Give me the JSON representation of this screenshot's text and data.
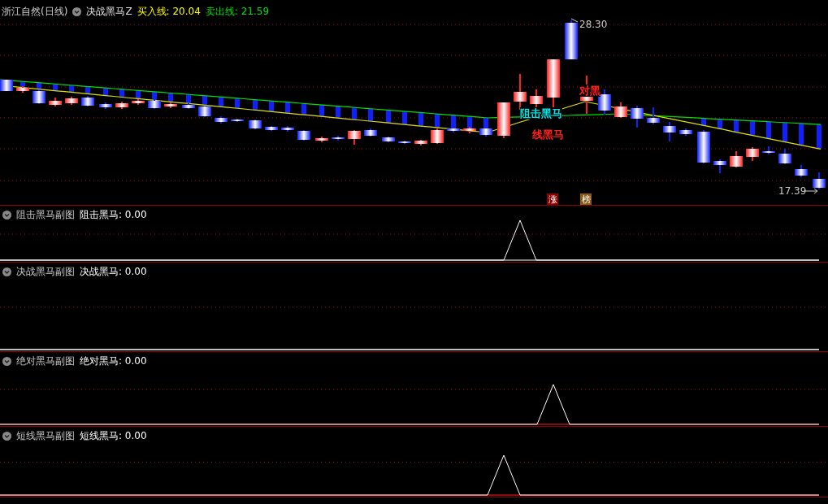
{
  "header": {
    "stock": "浙江自然(日线)",
    "indicator": "决战黑马Z",
    "buy_line": "买入线: 20.04",
    "sell_line": "卖出线: 21.59"
  },
  "annotations": [
    {
      "kind": "high",
      "text": "28.30"
    },
    {
      "kind": "low",
      "text": "17.39"
    },
    {
      "kind": "signal",
      "text": "阻击黑马",
      "color": "#00e5e5"
    },
    {
      "kind": "signal",
      "text": "线黑马",
      "color": "#ff2020"
    },
    {
      "kind": "signal",
      "text": "对黑",
      "color": "#ff2020"
    },
    {
      "kind": "badge",
      "text": "涨",
      "color": "#8b0000"
    },
    {
      "kind": "badge",
      "text": "榜",
      "color": "#8b5a1a"
    }
  ],
  "panels": [
    {
      "title": "阻击黑马副图",
      "series": "阻击黑马: 0.00"
    },
    {
      "title": "决战黑马副图",
      "series": "决战黑马: 0.00"
    },
    {
      "title": "绝对黑马副图",
      "series": "绝对黑马: 0.00"
    },
    {
      "title": "短线黑马副图",
      "series": "短线黑马: 0.00"
    }
  ]
}
